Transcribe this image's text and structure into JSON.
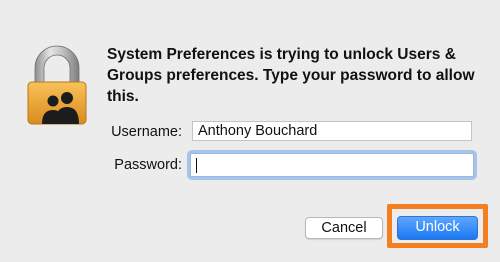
{
  "dialog": {
    "message": "System Preferences is trying to unlock Users & Groups preferences. Type your password to allow this.",
    "lock_icon": "padlock-users-icon"
  },
  "form": {
    "username_label": "Username:",
    "username_value": "Anthony Bouchard",
    "password_label": "Password:",
    "password_value": ""
  },
  "buttons": {
    "cancel_label": "Cancel",
    "unlock_label": "Unlock"
  },
  "colors": {
    "accent": "#1a78f2",
    "highlight": "#f47f20",
    "lock_gold": "#e9a53a"
  }
}
